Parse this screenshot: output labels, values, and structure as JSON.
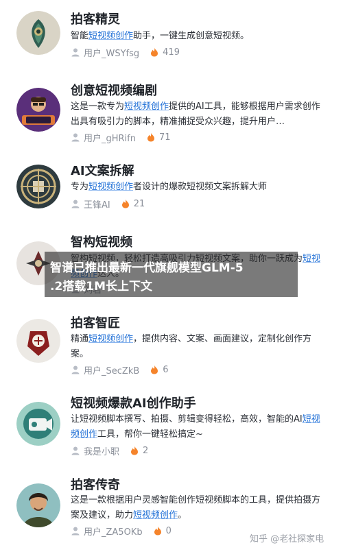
{
  "items": [
    {
      "title": "拍客精灵",
      "desc": [
        {
          "t": "智能"
        },
        {
          "t": "短视频创作",
          "hl": true
        },
        {
          "t": "助手，一键生成创意短视频。"
        }
      ],
      "user": "用户_WSYfsg",
      "count": "419"
    },
    {
      "title": "创意短视频编剧",
      "desc": [
        {
          "t": "这是一款专为"
        },
        {
          "t": "短视频创作",
          "hl": true
        },
        {
          "t": "提供的AI工具，能够根据用户需求创作出具有吸引力的脚本，精准捕捉受众兴趣，提升用户…"
        }
      ],
      "user": "用户_gHRifn",
      "count": "71"
    },
    {
      "title": "AI文案拆解",
      "desc": [
        {
          "t": "专为"
        },
        {
          "t": "短视频创作",
          "hl": true
        },
        {
          "t": "者设计的爆款短视频文案拆解大师"
        }
      ],
      "user": "王锋AI",
      "count": "21"
    },
    {
      "title": "智构短视频",
      "desc": [
        {
          "t": "智构短视频，轻松打造高吸引力短视频文案，助你一跃成为"
        },
        {
          "t": "短视频创作",
          "hl": true
        },
        {
          "t": "达人。"
        }
      ],
      "user": "刘君",
      "count": ""
    },
    {
      "title": "拍客智匠",
      "desc": [
        {
          "t": "精通"
        },
        {
          "t": "短视频创作",
          "hl": true
        },
        {
          "t": "，提供内容、文案、画面建议，定制化创作方案。"
        }
      ],
      "user": "用户_SecZkB",
      "count": "6"
    },
    {
      "title": "短视频爆款AI创作助手",
      "desc": [
        {
          "t": "让短视频脚本撰写、拍摄、剪辑变得轻松，高效，智能的AI"
        },
        {
          "t": "短视频创作",
          "hl": true
        },
        {
          "t": "工具，帮你一键轻松搞定~"
        }
      ],
      "user": "我是小职",
      "count": "2"
    },
    {
      "title": "拍客传奇",
      "desc": [
        {
          "t": "这是一款根据用户灵感智能创作短视频脚本的工具，提供拍摄方案及建议，助力"
        },
        {
          "t": "短视频创作",
          "hl": true
        },
        {
          "t": "。"
        }
      ],
      "user": "用户_ZA5OKb",
      "count": "0"
    }
  ],
  "overlay": {
    "line1": "智谱已推出最新一代旗舰模型GLM-5",
    "line2": ".2搭载1M长上下文"
  },
  "watermark": "知乎 @老社探家电",
  "colors": {
    "highlight": "#1f6fd6",
    "fire": "#f5842b",
    "meta": "#8a8f99"
  }
}
